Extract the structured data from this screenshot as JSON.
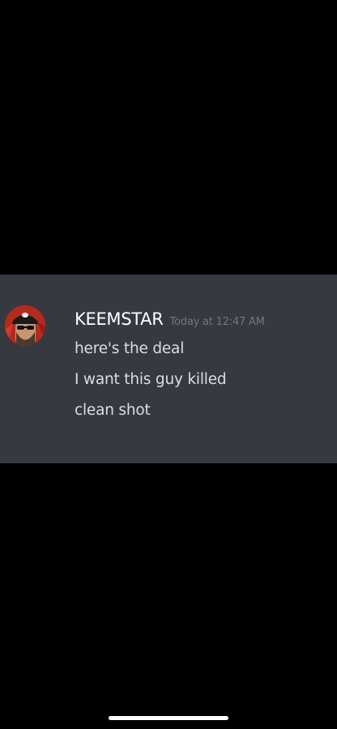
{
  "message": {
    "author": "KEEMSTAR",
    "timestamp": "Today at 12:47 AM",
    "lines": [
      "here's the deal",
      "I want this guy killed",
      "clean shot"
    ]
  },
  "colors": {
    "panel_background": "#36393f",
    "username": "#ffffff",
    "timestamp": "#72767d",
    "message_text": "#dcddde"
  },
  "icons": {
    "avatar": "user-avatar"
  }
}
